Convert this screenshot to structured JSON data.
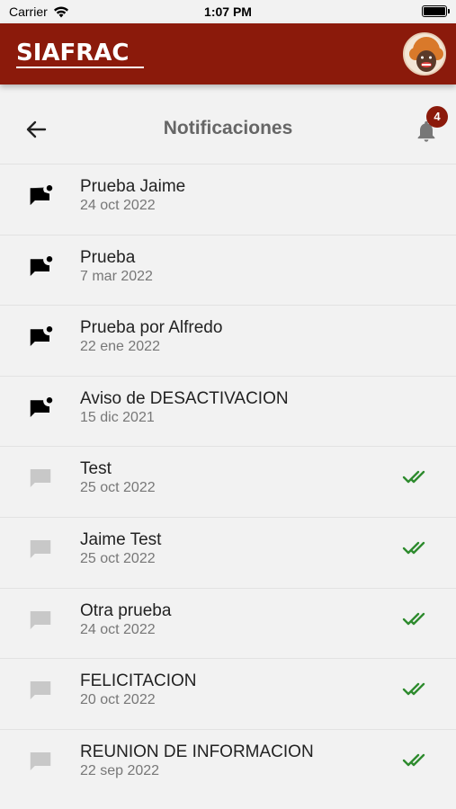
{
  "status_bar": {
    "carrier": "Carrier",
    "time": "1:07 PM"
  },
  "app_bar": {
    "logo": "SIAFRAC"
  },
  "header": {
    "title": "Notificaciones",
    "badge_count": "4"
  },
  "colors": {
    "brand": "#8b1a0b",
    "read_check": "#2e8b2e",
    "unread_icon": "#000000",
    "read_icon": "#c8c8c8"
  },
  "notifications": [
    {
      "title": "Prueba Jaime",
      "date": "24 oct 2022",
      "read": false,
      "icon": "unread-message-icon"
    },
    {
      "title": "Prueba",
      "date": "7 mar 2022",
      "read": false,
      "icon": "unread-message-icon"
    },
    {
      "title": "Prueba por Alfredo",
      "date": "22 ene 2022",
      "read": false,
      "icon": "unread-message-icon"
    },
    {
      "title": "Aviso de DESACTIVACION",
      "date": "15 dic 2021",
      "read": false,
      "icon": "unread-message-icon"
    },
    {
      "title": "Test",
      "date": "25 oct 2022",
      "read": true,
      "icon": "read-message-icon"
    },
    {
      "title": "Jaime Test",
      "date": "25 oct 2022",
      "read": true,
      "icon": "read-message-icon"
    },
    {
      "title": "Otra prueba",
      "date": "24 oct 2022",
      "read": true,
      "icon": "read-message-icon"
    },
    {
      "title": "FELICITACION",
      "date": "20 oct 2022",
      "read": true,
      "icon": "read-message-icon"
    },
    {
      "title": "REUNION DE INFORMACION",
      "date": "22 sep 2022",
      "read": true,
      "icon": "read-message-icon"
    }
  ]
}
